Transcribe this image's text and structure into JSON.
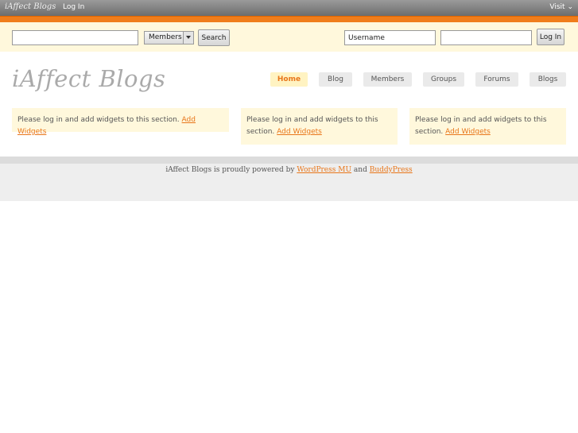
{
  "adminbar": {
    "brand": "iAffect Blogs",
    "login": "Log In",
    "visit": "Visit",
    "visit_arrow": "⌄"
  },
  "search": {
    "input_value": "",
    "select_value": "Members",
    "button_label": "Search"
  },
  "login": {
    "username_value": "Username",
    "password_value": "",
    "button_label": "Log In"
  },
  "header": {
    "logo": "iAffect Blogs"
  },
  "nav": {
    "home": "Home",
    "blog": "Blog",
    "members": "Members",
    "groups": "Groups",
    "forums": "Forums",
    "blogs": "Blogs"
  },
  "widgets": {
    "text": "Please log in and add widgets to this section.",
    "link": "Add Widgets"
  },
  "footer": {
    "prefix": "iAffect Blogs is proudly powered by",
    "link1": "WordPress MU",
    "and": "and",
    "link2": "BuddyPress"
  },
  "colors": {
    "accent": "#f07d1b",
    "band": "#fff8dc",
    "link": "#e8761a"
  }
}
